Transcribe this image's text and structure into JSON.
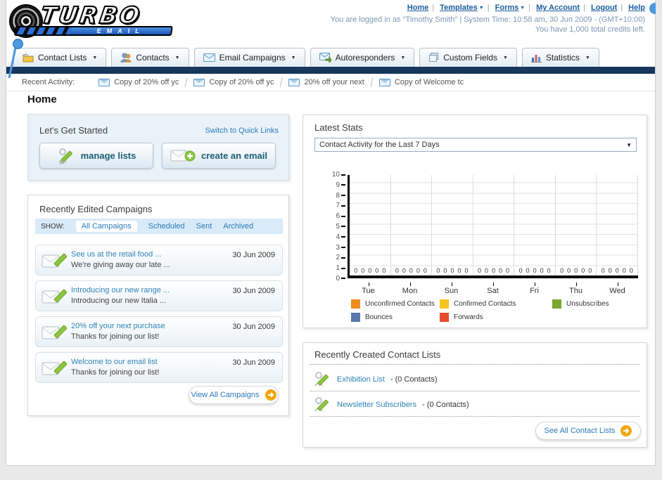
{
  "header": {
    "logo": {
      "title": "TURBO",
      "subtitle": "EMAIL"
    },
    "nav_links": [
      {
        "label": "Home",
        "dropdown": false
      },
      {
        "label": "Templates",
        "dropdown": true
      },
      {
        "label": "Forms",
        "dropdown": true
      },
      {
        "label": "My Account",
        "dropdown": false
      },
      {
        "label": "Logout",
        "dropdown": false
      },
      {
        "label": "Help",
        "dropdown": false
      }
    ],
    "separator": "|",
    "login_info": "You are logged in as \"Timothy Smith\" | System Time: 10:58 am, 30 Jun 2009 - (GMT+10:00)",
    "credits_info": "You have 1,000 total credits left."
  },
  "nav_tabs": [
    {
      "label": "Contact Lists",
      "icon": "folder-contact-icon"
    },
    {
      "label": "Contacts",
      "icon": "people-icon"
    },
    {
      "label": "Email Campaigns",
      "icon": "envelope-icon"
    },
    {
      "label": "Autoresponders",
      "icon": "envelope-arrow-icon"
    },
    {
      "label": "Custom Fields",
      "icon": "pages-icon"
    },
    {
      "label": "Statistics",
      "icon": "bar-chart-icon"
    }
  ],
  "recent_activity": {
    "label": "Recent Activity:",
    "items": [
      "Copy of 20% off yc",
      "Copy of 20% off yc",
      "20% off your next ",
      "Copy of Welcome tc"
    ]
  },
  "page_title": "Home",
  "get_started": {
    "title": "Let's Get Started",
    "switch_link": "Switch to Quick Links",
    "manage_lists_label": "manage lists",
    "create_email_label": "create an email"
  },
  "campaigns": {
    "title": "Recently Edited Campaigns",
    "show_label": "SHOW:",
    "filters": [
      "All Campaigns",
      "Scheduled",
      "Sent",
      "Archived"
    ],
    "active_filter": "All Campaigns",
    "rows": [
      {
        "title": "See us at the retail food ...",
        "subtitle": "We're giving away our late ...",
        "date": "30 Jun 2009"
      },
      {
        "title": "Introducing our new range ...",
        "subtitle": "Introducing our new Italia ...",
        "date": "30 Jun 2009"
      },
      {
        "title": "20% off your next purchase",
        "subtitle": "Thanks for joining our list!",
        "date": "30 Jun 2009"
      },
      {
        "title": "Welcome to our email list",
        "subtitle": "Thanks for joining our list!",
        "date": "30 Jun 2009"
      }
    ],
    "view_all_label": "View All Campaigns"
  },
  "latest_stats": {
    "title": "Latest Stats",
    "dropdown_value": "Contact Activity for the Last 7 Days"
  },
  "chart_data": {
    "type": "bar",
    "title": "Contact Activity for the Last 7 Days",
    "categories": [
      "Tue",
      "Mon",
      "Sun",
      "Sat",
      "Fri",
      "Thu",
      "Wed"
    ],
    "series": [
      {
        "name": "Unconfirmed Contacts",
        "color": "#F08C1E",
        "values": [
          0,
          0,
          0,
          0,
          0,
          0,
          0
        ]
      },
      {
        "name": "Confirmed Contacts",
        "color": "#F6C51F",
        "values": [
          0,
          0,
          0,
          0,
          0,
          0,
          0
        ]
      },
      {
        "name": "Unsubscribes",
        "color": "#7BA82E",
        "values": [
          0,
          0,
          0,
          0,
          0,
          0,
          0
        ]
      },
      {
        "name": "Bounces",
        "color": "#5878AB",
        "values": [
          0,
          0,
          0,
          0,
          0,
          0,
          0
        ]
      },
      {
        "name": "Forwards",
        "color": "#E74C2C",
        "values": [
          0,
          0,
          0,
          0,
          0,
          0,
          0
        ]
      }
    ],
    "ylim": [
      0,
      10
    ],
    "ytick_step": 1,
    "grid": true,
    "legend_position": "bottom",
    "value_labels_shown": true,
    "xlabel": "",
    "ylabel": ""
  },
  "contact_lists": {
    "title": "Recently Created Contact Lists",
    "items": [
      {
        "name": "Exhibition List",
        "detail": "- (0 Contacts)"
      },
      {
        "name": "Newsletter Subscribers",
        "detail": "- (0 Contacts)"
      }
    ],
    "see_all_label": "See All Contact Lists"
  }
}
